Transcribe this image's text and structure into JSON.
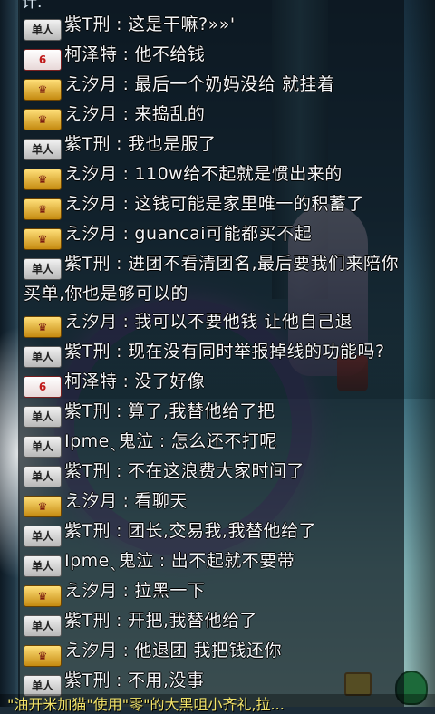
{
  "overflow_top": "计.",
  "badges": {
    "solo": "单人",
    "gold": "♛",
    "red": "6"
  },
  "messages": [
    {
      "badge": "solo",
      "name": "紫T刑",
      "text": "这是干嘛?»»'"
    },
    {
      "badge": "red",
      "name": "柯泽特",
      "text": "他不给钱"
    },
    {
      "badge": "gold",
      "name": "え汐月",
      "text": "最后一个奶妈没给 就挂着"
    },
    {
      "badge": "gold",
      "name": "え汐月",
      "text": "来捣乱的"
    },
    {
      "badge": "solo",
      "name": "紫T刑",
      "text": "我也是服了"
    },
    {
      "badge": "gold",
      "name": "え汐月",
      "text": "110w给不起就是惯出来的"
    },
    {
      "badge": "gold",
      "name": "え汐月",
      "text": "这钱可能是家里唯一的积蓄了"
    },
    {
      "badge": "gold",
      "name": "え汐月",
      "text": "guancai可能都买不起"
    },
    {
      "badge": "solo",
      "name": "紫T刑",
      "text": "进团不看清团名,最后要我们来陪你买单,你也是够可以的"
    },
    {
      "badge": "gold",
      "name": "え汐月",
      "text": "我可以不要他钱 让他自己退"
    },
    {
      "badge": "solo",
      "name": "紫T刑",
      "text": "现在没有同时举报掉线的功能吗?"
    },
    {
      "badge": "red",
      "name": "柯泽特",
      "text": "没了好像"
    },
    {
      "badge": "solo",
      "name": "紫T刑",
      "text": "算了,我替他给了把"
    },
    {
      "badge": "solo",
      "name": "Ipmeˎ鬼泣",
      "text": "怎么还不打呢"
    },
    {
      "badge": "solo",
      "name": "紫T刑",
      "text": "不在这浪费大家时间了"
    },
    {
      "badge": "gold",
      "name": "え汐月",
      "text": "看聊天"
    },
    {
      "badge": "solo",
      "name": "紫T刑",
      "text": "团长,交易我,我替他给了"
    },
    {
      "badge": "solo",
      "name": "Ipmeˎ鬼泣",
      "text": "出不起就不要带"
    },
    {
      "badge": "gold",
      "name": "え汐月",
      "text": "拉黑一下"
    },
    {
      "badge": "solo",
      "name": "紫T刑",
      "text": "开把,我替他给了"
    },
    {
      "badge": "gold",
      "name": "え汐月",
      "text": "他退团 我把钱还你"
    },
    {
      "badge": "solo",
      "name": "紫T刑",
      "text": "不用,没事"
    }
  ],
  "bottom_text": "\"油开米加猫\"使用\"零\"的大黑咀小齐礼,拉..."
}
